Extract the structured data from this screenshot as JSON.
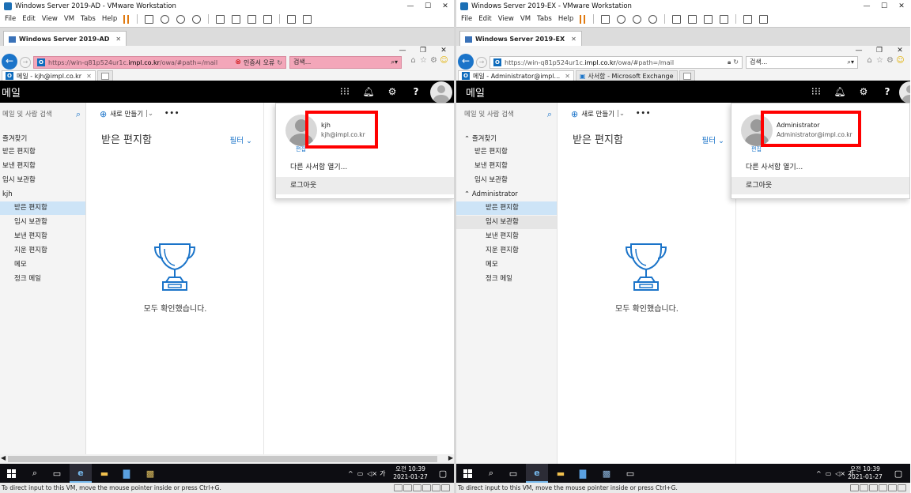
{
  "left": {
    "window_title": "Windows Server 2019-AD - VMware Workstation",
    "menu": [
      "File",
      "Edit",
      "View",
      "VM",
      "Tabs",
      "Help"
    ],
    "vm_tab": "Windows Server 2019-AD",
    "url_prefix": "https://win-q81p524ur1c.",
    "url_host": "impl.co.kr",
    "url_path": "/owa/#path=/mail",
    "cert_error": "인증서 오류",
    "search_placeholder": "검색...",
    "page_tab": "메일 - kjh@impl.co.kr",
    "owa_title": "메일",
    "nav_search": "메일 및 사람 검색",
    "new_button": "새로 만들기",
    "favorites": "즐겨찾기",
    "fav_items": [
      "받은 편지함",
      "보낸 편지함",
      "임시 보관함"
    ],
    "account": "kjh",
    "folders": [
      "받은 편지함",
      "임시 보관함",
      "보낸 편지함",
      "지운 편지함",
      "메모",
      "정크 메일"
    ],
    "inbox_header": "받은 편지함",
    "filter": "필터",
    "all_done": "모두 확인했습니다.",
    "popup": {
      "name": "kjh",
      "email": "kjh@impl.co.kr",
      "edit": "편집",
      "open_other": "다른 사서함 열기...",
      "logout": "로그아웃"
    },
    "clock_time": "오전 10:39",
    "clock_date": "2021-01-27",
    "status": "To direct input to this VM, move the mouse pointer inside or press Ctrl+G."
  },
  "right": {
    "window_title": "Windows Server 2019-EX - VMware Workstation",
    "menu": [
      "File",
      "Edit",
      "View",
      "VM",
      "Tabs",
      "Help"
    ],
    "vm_tab": "Windows Server 2019-EX",
    "url_prefix": "https://win-q81p524ur1c.",
    "url_host": "impl.co.kr",
    "url_path": "/owa/#path=/mail",
    "search_placeholder": "검색...",
    "page_tab": "메일 - Administrator@impl...",
    "page_tab2": "사서함 - Microsoft Exchange",
    "owa_title": "메일",
    "nav_search": "메일 및 사람 검색",
    "new_button": "새로 만들기",
    "favorites": "즐겨찾기",
    "fav_items": [
      "받은 편지함",
      "보낸 편지함",
      "임시 보관함"
    ],
    "account": "Administrator",
    "folders": [
      "받은 편지함",
      "임시 보관함",
      "보낸 편지함",
      "지운 편지함",
      "메모",
      "정크 메일"
    ],
    "inbox_header": "받은 편지함",
    "filter": "필터",
    "all_done": "모두 확인했습니다.",
    "popup": {
      "name": "Administrator",
      "email": "Administrator@impl.co.kr",
      "edit": "편집",
      "open_other": "다른 사서함 열기...",
      "logout": "로그아웃"
    },
    "clock_time": "오전 10:39",
    "clock_date": "2021-01-27",
    "status": "To direct input to this VM, move the mouse pointer inside or press Ctrl+G."
  },
  "colors": {
    "accent": "#1b74c9",
    "highlight": "#ff0000",
    "cert_error_bg": "#f3a6b9",
    "selected_folder": "#cde4f7"
  }
}
